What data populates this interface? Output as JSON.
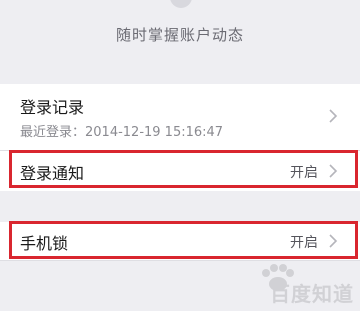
{
  "header": {
    "subtitle": "随时掌握账户动态"
  },
  "rows": {
    "login_record": {
      "title": "登录记录",
      "subtitle": "最近登录：2014-12-19 15:16:47"
    },
    "login_notify": {
      "title": "登录通知",
      "value": "开启"
    },
    "phone_lock": {
      "title": "手机锁",
      "value": "开启"
    }
  },
  "watermark": {
    "text": "百度知道"
  },
  "colors": {
    "highlight": "#d9262f",
    "background": "#eeeef2"
  }
}
